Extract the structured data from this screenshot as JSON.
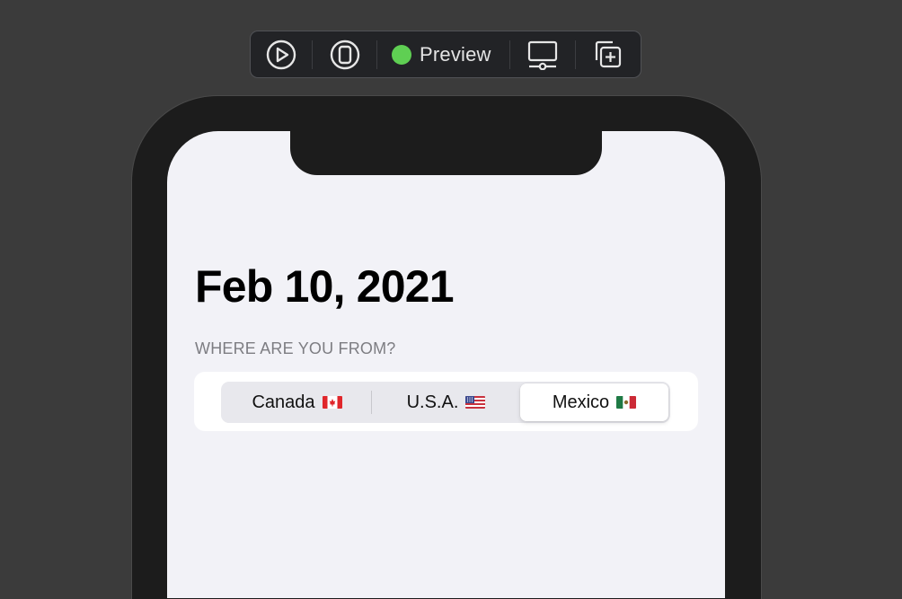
{
  "toolbar": {
    "live_icon": "play-circle-icon",
    "selectable_icon": "selectable-device-icon",
    "preview_label": "Preview",
    "preview_status_color": "#5fcf53",
    "device_settings_icon": "device-settings-icon",
    "duplicate_icon": "duplicate-preview-icon"
  },
  "screen": {
    "title": "Feb 10, 2021",
    "section_header": "WHERE ARE YOU FROM?",
    "picker": {
      "options": [
        {
          "label": "Canada",
          "flag": "canada-flag-icon"
        },
        {
          "label": "U.S.A.",
          "flag": "usa-flag-icon"
        },
        {
          "label": "Mexico",
          "flag": "mexico-flag-icon"
        }
      ],
      "selected": "Mexico"
    }
  }
}
